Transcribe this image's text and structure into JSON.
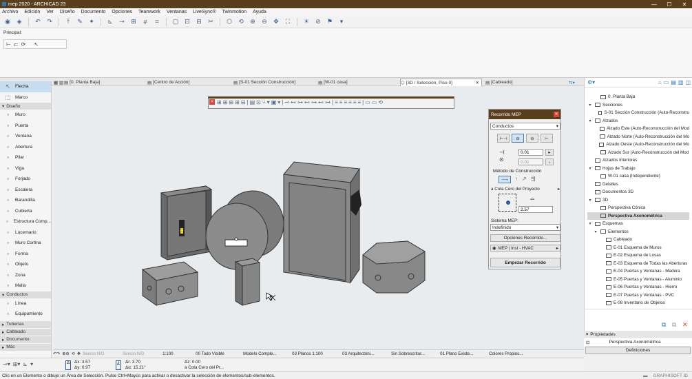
{
  "window": {
    "title": "mep 2020 - ARCHICAD 23",
    "min": "—",
    "max": "☐",
    "close": "✕"
  },
  "menu": [
    "Archivo",
    "Edición",
    "Ver",
    "Diseño",
    "Documento",
    "Opciones",
    "Teamwork",
    "Ventanas",
    "LiveSync®",
    "Twinmotion",
    "Ayuda"
  ],
  "infobox": {
    "label": "Principal:"
  },
  "tabs": [
    {
      "label": "[0. Planta Baja]",
      "icon": "plan-icon"
    },
    {
      "label": "[Centro de Acción]",
      "icon": "action-center-icon"
    },
    {
      "label": "[S-01 Sección Construcción]",
      "icon": "section-icon"
    },
    {
      "label": "[W-01 casa]",
      "icon": "worksheet-icon"
    },
    {
      "label": "[3D / Selección, Piso 0]",
      "icon": "3d-icon"
    },
    {
      "label": "[Cableado]",
      "icon": "schedule-icon"
    }
  ],
  "toolbox": {
    "top": [
      {
        "label": "Flecha",
        "icon": "arrow-icon",
        "selected": true
      },
      {
        "label": "Marco",
        "icon": "marquee-icon"
      }
    ],
    "diseno_title": "Diseño",
    "diseno": [
      {
        "label": "Muro",
        "icon": "wall-icon"
      },
      {
        "label": "Puerta",
        "icon": "door-icon"
      },
      {
        "label": "Ventana",
        "icon": "window-icon"
      },
      {
        "label": "Abertura",
        "icon": "opening-icon"
      },
      {
        "label": "Pilar",
        "icon": "column-icon"
      },
      {
        "label": "Viga",
        "icon": "beam-icon"
      },
      {
        "label": "Forjado",
        "icon": "slab-icon"
      },
      {
        "label": "Escalera",
        "icon": "stair-icon"
      },
      {
        "label": "Barandilla",
        "icon": "railing-icon"
      },
      {
        "label": "Cubierta",
        "icon": "roof-icon"
      },
      {
        "label": "Estructura Comp...",
        "icon": "curtain-wall-icon"
      },
      {
        "label": "Lucernario",
        "icon": "skylight-icon"
      },
      {
        "label": "Muro Cortina",
        "icon": "curtain-icon"
      },
      {
        "label": "Forma",
        "icon": "morph-icon"
      },
      {
        "label": "Objeto",
        "icon": "object-icon"
      },
      {
        "label": "Zona",
        "icon": "zone-icon"
      },
      {
        "label": "Malla",
        "icon": "mesh-icon"
      }
    ],
    "conductos_title": "Conductos",
    "conductos": [
      {
        "label": "Línea",
        "icon": "line-icon"
      },
      {
        "label": "Equipamiento",
        "icon": "equipment-icon"
      }
    ],
    "collapsed": [
      "Tuberías",
      "Cableado",
      "Documento",
      "Más"
    ]
  },
  "mep_dialog": {
    "title": "Recorrido MEP",
    "domain_select": "Conductos",
    "width_value": "0.01",
    "height_value": "0.01",
    "metodo_label": "Método de Construcción",
    "cota_label": "a Cota Cero del Proyecto",
    "elevation_value": "2.57",
    "sistema_label": "Sistema MEP:",
    "sistema_value": "Indefinido",
    "opciones_button": "Opciones Recorrido...",
    "layer_value": "MEP | Inst - HVAC",
    "empezar_button": "Empezar Recorrido"
  },
  "navigator": {
    "items": [
      {
        "label": "0. Planta Baja",
        "level": 2,
        "twisty": ""
      },
      {
        "label": "Secciones",
        "level": 1,
        "twisty": "▾"
      },
      {
        "label": "S-01 Sección Construcción (Auto-Reconstru",
        "level": 2,
        "twisty": ""
      },
      {
        "label": "Alzados",
        "level": 1,
        "twisty": "▾"
      },
      {
        "label": "Alzado Este (Auto-Reconstrucción del Mod",
        "level": 2,
        "twisty": ""
      },
      {
        "label": "Alzado Norte (Auto-Reconstrucción del Mo",
        "level": 2,
        "twisty": ""
      },
      {
        "label": "Alzado Oeste (Auto-Reconstrucción del Mo",
        "level": 2,
        "twisty": ""
      },
      {
        "label": "Alzado Sur (Auto-Reconstrucción del Mod",
        "level": 2,
        "twisty": ""
      },
      {
        "label": "Alzados Interiores",
        "level": 1,
        "twisty": ""
      },
      {
        "label": "Hojas de Trabajo",
        "level": 1,
        "twisty": "▾"
      },
      {
        "label": "W-01 casa (Independiente)",
        "level": 2,
        "twisty": ""
      },
      {
        "label": "Detalles",
        "level": 1,
        "twisty": ""
      },
      {
        "label": "Documentos 3D",
        "level": 1,
        "twisty": ""
      },
      {
        "label": "3D",
        "level": 1,
        "twisty": "▾"
      },
      {
        "label": "Perspectiva Cónica",
        "level": 2,
        "twisty": ""
      },
      {
        "label": "Perspectiva Axonométrica",
        "level": 2,
        "twisty": "",
        "selected": true
      },
      {
        "label": "Esquemas",
        "level": 1,
        "twisty": "▾"
      },
      {
        "label": "Elementos",
        "level": 2,
        "twisty": "▾"
      },
      {
        "label": "Cableado",
        "level": 3,
        "twisty": ""
      },
      {
        "label": "E-01 Esquema de Muros",
        "level": 3,
        "twisty": ""
      },
      {
        "label": "E-02 Esquema de Losas",
        "level": 3,
        "twisty": ""
      },
      {
        "label": "E-03 Esquema de Todas las Aberturas",
        "level": 3,
        "twisty": ""
      },
      {
        "label": "E-04 Puertas y Ventanas - Madera",
        "level": 3,
        "twisty": ""
      },
      {
        "label": "E-05 Puertas y Ventanas - Aluminio",
        "level": 3,
        "twisty": ""
      },
      {
        "label": "E-06 Puertas y Ventanas - Hierro",
        "level": 3,
        "twisty": ""
      },
      {
        "label": "E-07 Puertas y Ventanas - PVC",
        "level": 3,
        "twisty": ""
      },
      {
        "label": "E-08 Inventario de Objetos",
        "level": 3,
        "twisty": ""
      }
    ],
    "propiedades_title": "Propiedades",
    "propiedades_value": "Perspectiva Axonométrica",
    "definiciones_button": "Definiciones"
  },
  "bottom_bar": [
    "Sencio N/D",
    "Sencio N/D",
    "1:100",
    "00 Todo Visible",
    "Modelo Comple...",
    "03 Planos 1:100",
    "03 Arquitectóni...",
    "Sin Sobrescritur...",
    "01 Plano Existe...",
    "Colores Propios..."
  ],
  "coords": {
    "ax": "Δx: 3.57",
    "ay": "Δy: 0.97",
    "ar": "Δr: 3.70",
    "aa": "Δα: 15.21°",
    "az": "Δz: 0.00",
    "cota": "a Cota Cero del Pr..."
  },
  "status": {
    "message": "Clic en un Elemento o dibuje un Área de Selección. Pulse Ctrl+Mayús para activar o desactivar la selección de elementos/sub-elementos.",
    "brand": "GRAPHISOFT ID"
  }
}
